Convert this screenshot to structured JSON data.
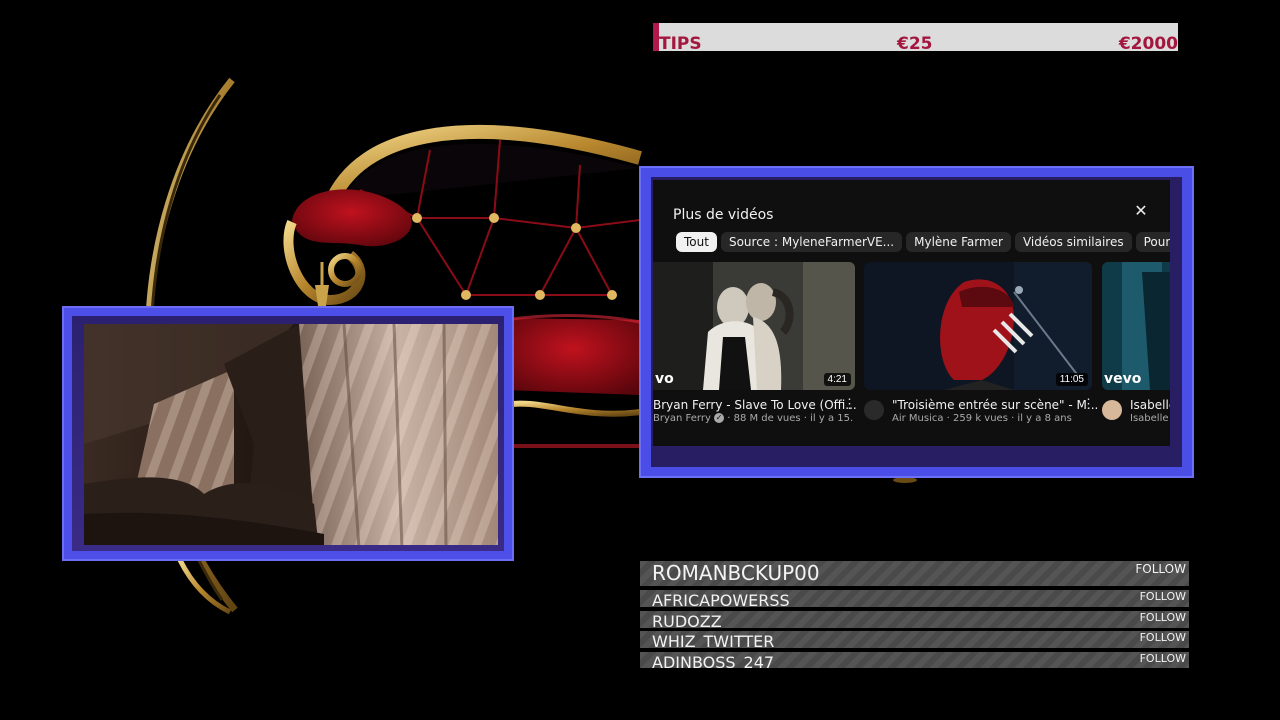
{
  "tips": {
    "label": "TIPS",
    "min": "€25",
    "max": "€2000"
  },
  "youtube_panel": {
    "title": "Plus de vidéos",
    "close_icon": "close-icon",
    "chips": [
      "Tout",
      "Source : MyleneFarmerVE...",
      "Mylène Farmer",
      "Vidéos similaires",
      "Pour vou"
    ],
    "active_chip": "Tout",
    "videos": [
      {
        "title": "Bryan Ferry - Slave To Love (Offi...",
        "channel": "Bryan Ferry",
        "verified": true,
        "meta": "88 M de vues · il y a 15.",
        "duration": "4:21",
        "badge": "vo"
      },
      {
        "title": "\"Troisième entrée sur scène\" - M...",
        "channel": "Air Musica",
        "meta": "259 k vues · il y a 8 ans",
        "duration": "11:05"
      },
      {
        "title": "Isabelle ..",
        "channel": "Isabelle A",
        "meta": "",
        "badge": "vevo"
      }
    ]
  },
  "followers": {
    "latest": "ROMANBCKUP00",
    "list": [
      "AFRICAPOWERSS",
      "RUDOZZ",
      "WHIZ_TWITTER",
      "ADINBOSS_247"
    ],
    "follow_label": "FOLLOW"
  },
  "colors": {
    "frame_blue": "#4d50e8",
    "tips_accent": "#b2194b",
    "tips_text": "#a3173f",
    "sofa_red": "#a0101c",
    "sofa_gold": "#c9a24a"
  }
}
